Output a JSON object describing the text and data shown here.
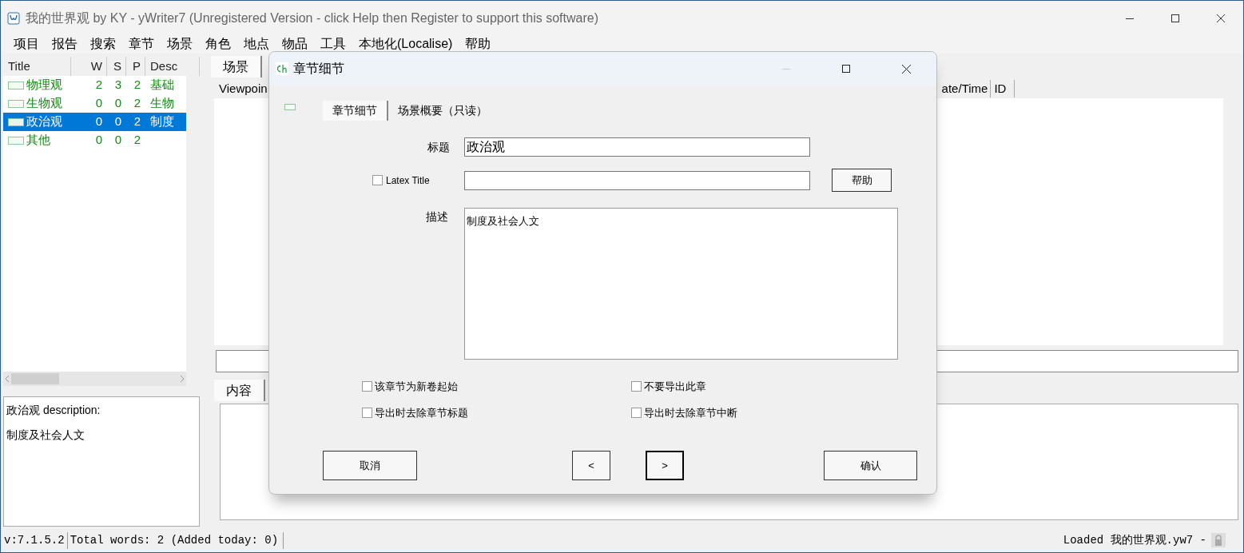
{
  "window": {
    "title": "我的世界观 by KY - yWriter7 (Unregistered Version - click Help then Register to support this software)"
  },
  "menu": [
    "项目",
    "报告",
    "搜索",
    "章节",
    "场景",
    "角色",
    "地点",
    "物品",
    "工具",
    "本地化(Localise)",
    "帮助"
  ],
  "chapter_list": {
    "columns": [
      "Title",
      "W",
      "S",
      "P",
      "Desc"
    ],
    "rows": [
      {
        "title": "物理观",
        "w": "2",
        "s": "3",
        "p": "2",
        "desc": "基础",
        "selected": false
      },
      {
        "title": "生物观",
        "w": "0",
        "s": "0",
        "p": "2",
        "desc": "生物",
        "selected": false
      },
      {
        "title": "政治观",
        "w": "0",
        "s": "0",
        "p": "2",
        "desc": "制度",
        "selected": true
      },
      {
        "title": "其他",
        "w": "0",
        "s": "0",
        "p": "2",
        "selected": false
      }
    ]
  },
  "description_panel": {
    "heading": "政治观 description:",
    "text": "制度及社会人文"
  },
  "scene_tabs": [
    {
      "label": "场景",
      "selected": true
    }
  ],
  "scene_table": {
    "columns": [
      "Viewpoin",
      "ate/Time",
      "ID"
    ]
  },
  "content_tabs": [
    {
      "label": "内容",
      "selected": true
    }
  ],
  "status_bar": {
    "version": "v:7.1.5.2",
    "words": "Total words: 2 (Added today: 0)",
    "loaded": "Loaded 我的世界观.yw7 -"
  },
  "dialog": {
    "title": "章节细节",
    "tabs": [
      {
        "label": "章节细节",
        "selected": true
      },
      {
        "label": "场景概要（只读）",
        "selected": false
      }
    ],
    "title_label": "标题",
    "title_value": "政治观",
    "latex": {
      "label": "Latex Title",
      "checked": false
    },
    "help_button": "帮助",
    "desc_label": "描述",
    "desc_value": "制度及社会人文",
    "options": [
      {
        "label": "该章节为新卷起始",
        "checked": false
      },
      {
        "label": "不要导出此章",
        "checked": false
      },
      {
        "label": "导出时去除章节标题",
        "checked": false
      },
      {
        "label": "导出时去除章节中断",
        "checked": false
      }
    ],
    "buttons": [
      {
        "label": "取消",
        "kind": "cancel"
      },
      {
        "label": "<",
        "kind": "prev"
      },
      {
        "label": ">",
        "kind": "next"
      },
      {
        "label": "确认",
        "kind": "ok"
      }
    ]
  }
}
